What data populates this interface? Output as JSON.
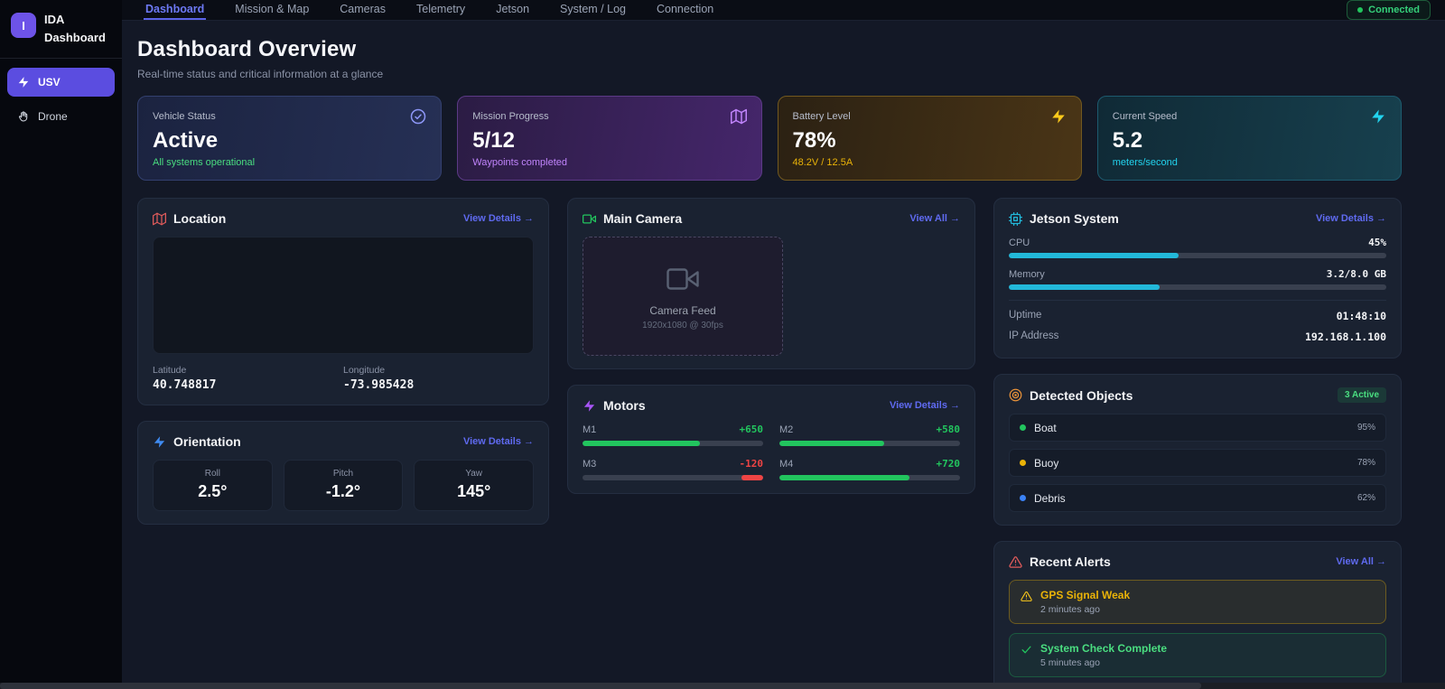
{
  "sidebar": {
    "logo_letter": "I",
    "logo_line1": "IDA",
    "logo_line2": "Dashboard",
    "items": [
      {
        "label": "USV",
        "icon": "lightning-icon",
        "active": true
      },
      {
        "label": "Drone",
        "icon": "hand-icon",
        "active": false
      }
    ]
  },
  "topnav": {
    "tabs": [
      {
        "label": "Dashboard",
        "active": true
      },
      {
        "label": "Mission & Map",
        "active": false
      },
      {
        "label": "Cameras",
        "active": false
      },
      {
        "label": "Telemetry",
        "active": false
      },
      {
        "label": "Jetson",
        "active": false
      },
      {
        "label": "System / Log",
        "active": false
      },
      {
        "label": "Connection",
        "active": false
      }
    ],
    "connection_status": "Connected"
  },
  "header": {
    "title": "Dashboard Overview",
    "subtitle": "Real-time status and critical information at a glance"
  },
  "stat_cards": [
    {
      "label": "Vehicle Status",
      "value": "Active",
      "sub": "All systems operational",
      "sub_color": "#4ade80",
      "icon": "check-circle-icon",
      "theme": "blue"
    },
    {
      "label": "Mission Progress",
      "value": "5/12",
      "sub": "Waypoints completed",
      "sub_color": "#c084fc",
      "icon": "map-icon",
      "theme": "purple"
    },
    {
      "label": "Battery Level",
      "value": "78%",
      "sub": "48.2V / 12.5A",
      "sub_color": "#eab308",
      "icon": "lightning-icon",
      "theme": "amber"
    },
    {
      "label": "Current Speed",
      "value": "5.2",
      "sub": "meters/second",
      "sub_color": "#22d3ee",
      "icon": "lightning-icon",
      "theme": "cyan"
    }
  ],
  "location": {
    "title": "Location",
    "link": "View Details →",
    "latitude_label": "Latitude",
    "latitude": "40.748817",
    "longitude_label": "Longitude",
    "longitude": "-73.985428"
  },
  "orientation": {
    "title": "Orientation",
    "link": "View Details →",
    "values": [
      {
        "label": "Roll",
        "value": "2.5°"
      },
      {
        "label": "Pitch",
        "value": "-1.2°"
      },
      {
        "label": "Yaw",
        "value": "145°"
      }
    ]
  },
  "camera": {
    "title": "Main Camera",
    "link": "View All →",
    "feed_label": "Camera Feed",
    "feed_spec": "1920x1080 @ 30fps"
  },
  "motors": {
    "title": "Motors",
    "link": "View Details →",
    "items": [
      {
        "label": "M1",
        "value": "+650",
        "pct": 65,
        "color": "#22c55e",
        "negative": false
      },
      {
        "label": "M2",
        "value": "+580",
        "pct": 58,
        "color": "#22c55e",
        "negative": false
      },
      {
        "label": "M3",
        "value": "-120",
        "pct": 12,
        "color": "#ef4444",
        "negative": true
      },
      {
        "label": "M4",
        "value": "+720",
        "pct": 72,
        "color": "#22c55e",
        "negative": false
      }
    ]
  },
  "jetson": {
    "title": "Jetson System",
    "link": "View Details →",
    "cpu_label": "CPU",
    "cpu_value": "45%",
    "cpu_pct": 45,
    "memory_label": "Memory",
    "memory_value": "3.2/8.0 GB",
    "memory_pct": 40,
    "uptime_label": "Uptime",
    "uptime_value": "01:48:10",
    "ip_label": "IP Address",
    "ip_value": "192.168.1.100",
    "bar_color": "#22b8d9"
  },
  "detected_objects": {
    "title": "Detected Objects",
    "badge": "3 Active",
    "items": [
      {
        "label": "Boat",
        "confidence": "95%",
        "dot_color": "#22c55e"
      },
      {
        "label": "Buoy",
        "confidence": "78%",
        "dot_color": "#eab308"
      },
      {
        "label": "Debris",
        "confidence": "62%",
        "dot_color": "#3b82f6"
      }
    ]
  },
  "alerts": {
    "title": "Recent Alerts",
    "link": "View All →",
    "items": [
      {
        "title": "GPS Signal Weak",
        "time": "2 minutes ago",
        "type": "warning"
      },
      {
        "title": "System Check Complete",
        "time": "5 minutes ago",
        "type": "success"
      }
    ]
  },
  "colors": {
    "accent_indigo": "#5b4de0",
    "link": "#5f6af0",
    "success": "#22c55e",
    "warning": "#eab308",
    "danger": "#ef4444",
    "cyan": "#22d3ee",
    "card_bg": "#1a2231",
    "page_bg": "#131826",
    "sidebar_bg": "#06080e"
  }
}
